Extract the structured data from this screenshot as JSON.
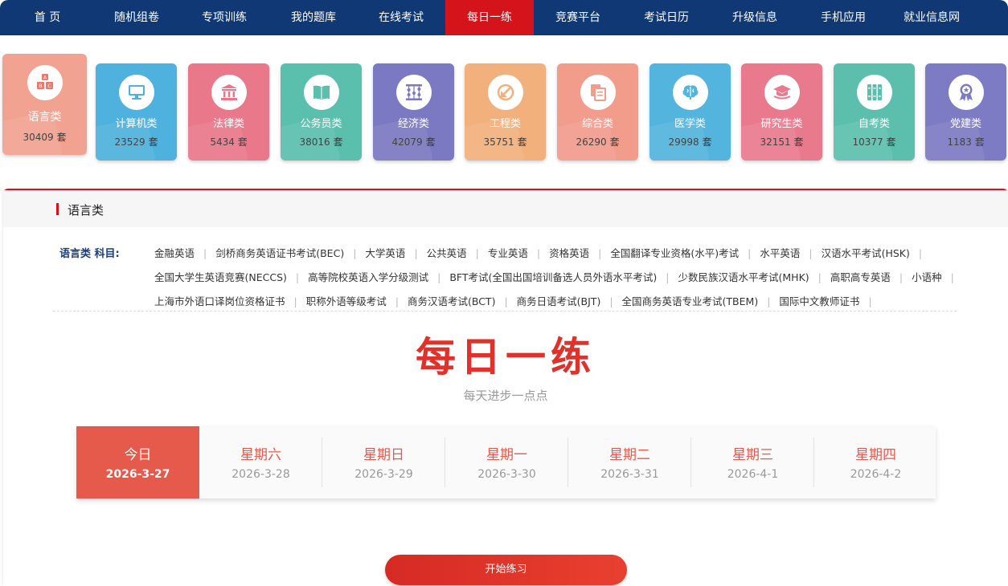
{
  "nav": {
    "items": [
      "首 页",
      "随机组卷",
      "专项训练",
      "我的题库",
      "在线考试",
      "每日一练",
      "竞赛平台",
      "考试日历",
      "升级信息",
      "手机应用",
      "就业信息网"
    ],
    "active_index": 5,
    "colors": {
      "bg": "#0f3874",
      "active": "#d4131a"
    }
  },
  "categories": [
    {
      "name": "语言类",
      "count": "30409 套",
      "color": "#f2a291",
      "icon": "abc-blocks-icon"
    },
    {
      "name": "计算机类",
      "count": "23529 套",
      "color": "#4fb1dd",
      "icon": "monitor-icon"
    },
    {
      "name": "法律类",
      "count": "5434 套",
      "color": "#e9788b",
      "icon": "courthouse-icon"
    },
    {
      "name": "公务员类",
      "count": "38016 套",
      "color": "#5bbfae",
      "icon": "book-icon"
    },
    {
      "name": "经济类",
      "count": "42079 套",
      "color": "#7b79c1",
      "icon": "abacus-icon"
    },
    {
      "name": "工程类",
      "count": "35751 套",
      "color": "#f2b07c",
      "icon": "ruler-icon"
    },
    {
      "name": "综合类",
      "count": "26290 套",
      "color": "#f29c8c",
      "icon": "files-icon"
    },
    {
      "name": "医学类",
      "count": "29998 套",
      "color": "#53b5de",
      "icon": "brain-icon"
    },
    {
      "name": "研究生类",
      "count": "32151 套",
      "color": "#e97a8e",
      "icon": "graduation-cap-icon"
    },
    {
      "name": "自考类",
      "count": "10377 套",
      "color": "#5cbfad",
      "icon": "binders-icon"
    },
    {
      "name": "党建类",
      "count": "1183 套",
      "color": "#7d7bc4",
      "icon": "medal-icon"
    }
  ],
  "panel": {
    "title": "语言类",
    "subjects_label": "语言类 科目:",
    "subject_rows": [
      [
        "金融英语",
        "剑桥商务英语证书考试(BEC)",
        "大学英语",
        "公共英语",
        "专业英语",
        "资格英语",
        "全国翻译专业资格(水平)考试",
        "水平英语",
        "汉语水平考试(HSK)"
      ],
      [
        "全国大学生英语竞赛(NECCS)",
        "高等院校英语入学分级测试",
        "BFT考试(全国出国培训备选人员外语水平考试)",
        "少数民族汉语水平考试(MHK)",
        "高职高专英语",
        "小语种"
      ],
      [
        "上海市外语口译岗位资格证书",
        "职称外语等级考试",
        "商务汉语考试(BCT)",
        "商务日语考试(BJT)",
        "全国商务英语专业考试(TBEM)",
        "国际中文教师证书"
      ]
    ]
  },
  "daily": {
    "title": "每日一练",
    "slogan": "每天进步一点点",
    "days": [
      {
        "week": "今日",
        "date": "2026-3-27"
      },
      {
        "week": "星期六",
        "date": "2026-3-28"
      },
      {
        "week": "星期日",
        "date": "2026-3-29"
      },
      {
        "week": "星期一",
        "date": "2026-3-30"
      },
      {
        "week": "星期二",
        "date": "2026-3-31"
      },
      {
        "week": "星期三",
        "date": "2026-4-1"
      },
      {
        "week": "星期四",
        "date": "2026-4-2"
      }
    ],
    "today_color": "#e55a4b",
    "start_label": "开始练习"
  }
}
